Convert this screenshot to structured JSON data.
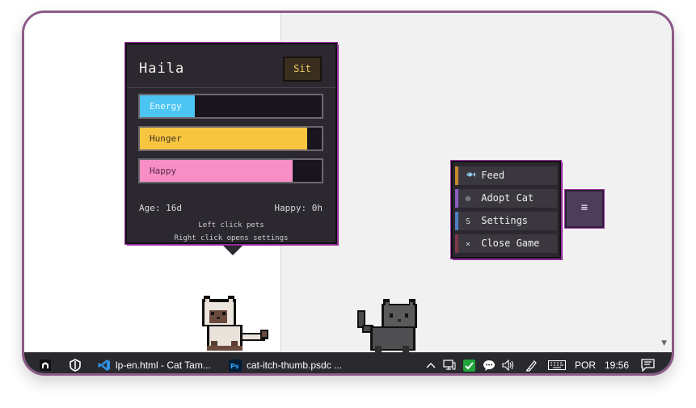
{
  "stats_panel": {
    "cat_name": "Haila",
    "sit_button": "Sit",
    "bars": [
      {
        "label": "Energy",
        "level": 0.3,
        "color": "#4cc5f2"
      },
      {
        "label": "Hunger",
        "level": 0.92,
        "color": "#f8c540"
      },
      {
        "label": "Happy",
        "level": 0.84,
        "color": "#f78ec6"
      }
    ],
    "age": "Age: 16d",
    "happy_time": "Happy: 0h",
    "hint_left": "Left click pets",
    "hint_right": "Right click opens settings"
  },
  "menu": {
    "items": [
      {
        "icon": "fish-icon",
        "label": "Feed",
        "accent": "#c9892d"
      },
      {
        "icon": "target-icon",
        "glyph": "⊙",
        "label": "Adopt Cat",
        "accent": "#8a5fc0"
      },
      {
        "icon": "settings-icon",
        "glyph": "S",
        "label": "Settings",
        "accent": "#4f7fc2"
      },
      {
        "icon": "close-icon",
        "glyph": "×",
        "label": "Close Game",
        "accent": "#7a3b45"
      }
    ],
    "toggle_glyph": "≡"
  },
  "taskbar": {
    "apps": [
      {
        "name": "cave-app",
        "label": ""
      },
      {
        "name": "shield-app",
        "label": ""
      },
      {
        "name": "vscode",
        "label": "lp-en.html - Cat Tam..."
      },
      {
        "name": "photoshop",
        "label": "cat-itch-thumb.psdc ..."
      }
    ],
    "language": "POR",
    "time": "19:56",
    "colors": {
      "vscode": "#2f8fde",
      "photoshop": "#31a8ff",
      "check": "#1fa33a"
    }
  }
}
